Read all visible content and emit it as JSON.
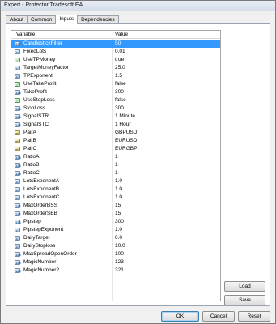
{
  "window": {
    "title": "Expert - Protector Tradesoft EA"
  },
  "tabs": [
    {
      "label": "About"
    },
    {
      "label": "Common"
    },
    {
      "label": "Inputs"
    },
    {
      "label": "Dependencies"
    }
  ],
  "table": {
    "col_variable": "Variable",
    "col_value": "Value",
    "rows": [
      {
        "name": "CandlestickFilter",
        "value": "50",
        "icon": "int"
      },
      {
        "name": "FixedLots",
        "value": "0.01",
        "icon": "dbl"
      },
      {
        "name": "UseTPMoney",
        "value": "true",
        "icon": "bool"
      },
      {
        "name": "TargetMoneyFactor",
        "value": "25.0",
        "icon": "dbl"
      },
      {
        "name": "TPExponent",
        "value": "1.5",
        "icon": "dbl"
      },
      {
        "name": "UseTakeProfit",
        "value": "false",
        "icon": "bool"
      },
      {
        "name": "TakeProfit",
        "value": "300",
        "icon": "int"
      },
      {
        "name": "UseStopLoss",
        "value": "false",
        "icon": "bool"
      },
      {
        "name": "StopLoss",
        "value": "300",
        "icon": "int"
      },
      {
        "name": "SignalSTR",
        "value": "1 Minute",
        "icon": "int"
      },
      {
        "name": "SignalSTC",
        "value": "1 Hour",
        "icon": "int"
      },
      {
        "name": "PairA",
        "value": "GBPUSD",
        "icon": "ab"
      },
      {
        "name": "PairB",
        "value": "EURUSD",
        "icon": "ab"
      },
      {
        "name": "PairC",
        "value": "EURGBP",
        "icon": "ab"
      },
      {
        "name": "RatioA",
        "value": "1",
        "icon": "int"
      },
      {
        "name": "RatioB",
        "value": "1",
        "icon": "int"
      },
      {
        "name": "RatioC",
        "value": "1",
        "icon": "int"
      },
      {
        "name": "LotsExponentA",
        "value": "1.0",
        "icon": "dbl"
      },
      {
        "name": "LotsExponentB",
        "value": "1.0",
        "icon": "dbl"
      },
      {
        "name": "LotsExponentC",
        "value": "1.0",
        "icon": "dbl"
      },
      {
        "name": "MaxOrderBSS",
        "value": "15",
        "icon": "int"
      },
      {
        "name": "MaxOrderSBB",
        "value": "15",
        "icon": "int"
      },
      {
        "name": "Pipstep",
        "value": "300",
        "icon": "int"
      },
      {
        "name": "PipstepExponent",
        "value": "1.0",
        "icon": "dbl"
      },
      {
        "name": "DailyTarget",
        "value": "0.0",
        "icon": "dbl"
      },
      {
        "name": "DailyStoploss",
        "value": "10.0",
        "icon": "dbl"
      },
      {
        "name": "MaxSpreadOpenOrder",
        "value": "100",
        "icon": "int"
      },
      {
        "name": "MagicNumber",
        "value": "123",
        "icon": "int"
      },
      {
        "name": "MagicNumber2",
        "value": "321",
        "icon": "int"
      }
    ]
  },
  "buttons": {
    "load": "Load",
    "save": "Save",
    "ok": "OK",
    "cancel": "Cancel",
    "reset": "Reset"
  },
  "colors": {
    "selection": "#3399ff"
  }
}
